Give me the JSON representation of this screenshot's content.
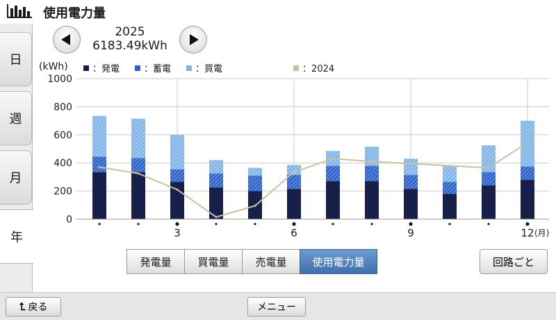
{
  "app": {
    "title": "使用電力量",
    "icon": "bar-chart-icon"
  },
  "side_tabs": [
    {
      "label": "日",
      "active": false
    },
    {
      "label": "週",
      "active": false
    },
    {
      "label": "月",
      "active": false
    },
    {
      "label": "年",
      "active": true
    }
  ],
  "period": {
    "year": "2025",
    "total": "6183.49kWh"
  },
  "legend": {
    "unit": "(kWh)",
    "generation": "：発電",
    "storage": "：蓄電",
    "purchase": "：買電",
    "previous_year": "：2024"
  },
  "colors": {
    "generation": "#16204a",
    "storage": "#2f62c4",
    "purchase": "#7fb2e6",
    "previous_year": "#cdbfa4",
    "active_button": "#4a7bbd"
  },
  "chart_data": {
    "type": "bar",
    "stacked": true,
    "categories": [
      "1",
      "2",
      "3",
      "4",
      "5",
      "6",
      "7",
      "8",
      "9",
      "10",
      "11",
      "12"
    ],
    "tick_labels": [
      "•",
      "•",
      "3",
      "•",
      "•",
      "6",
      "•",
      "•",
      "9",
      "•",
      "•",
      "12"
    ],
    "x_unit": "(月)",
    "series": [
      {
        "name": "発電",
        "values": [
          335,
          335,
          265,
          225,
          200,
          215,
          270,
          270,
          215,
          180,
          240,
          280
        ]
      },
      {
        "name": "蓄電",
        "values": [
          110,
          100,
          90,
          100,
          110,
          100,
          110,
          110,
          100,
          85,
          95,
          95
        ]
      },
      {
        "name": "買電",
        "values": [
          290,
          280,
          245,
          95,
          55,
          70,
          105,
          135,
          115,
          115,
          190,
          325
        ]
      },
      {
        "name": "2024",
        "type": "line",
        "values": [
          370,
          325,
          210,
          15,
          95,
          335,
          430,
          410,
          395,
          380,
          365,
          545
        ]
      }
    ],
    "yticks": [
      0,
      200,
      400,
      600,
      800,
      1000
    ],
    "ylim": [
      0,
      1000
    ],
    "ylabel": "(kWh)",
    "grid": true
  },
  "mode_buttons": [
    {
      "label": "発電量",
      "active": false
    },
    {
      "label": "買電量",
      "active": false
    },
    {
      "label": "売電量",
      "active": false
    },
    {
      "label": "使用電力量",
      "active": true
    }
  ],
  "circuit_button": {
    "label": "回路ごと"
  },
  "footer": {
    "back_label": "戻る",
    "menu_label": "メニュー"
  }
}
